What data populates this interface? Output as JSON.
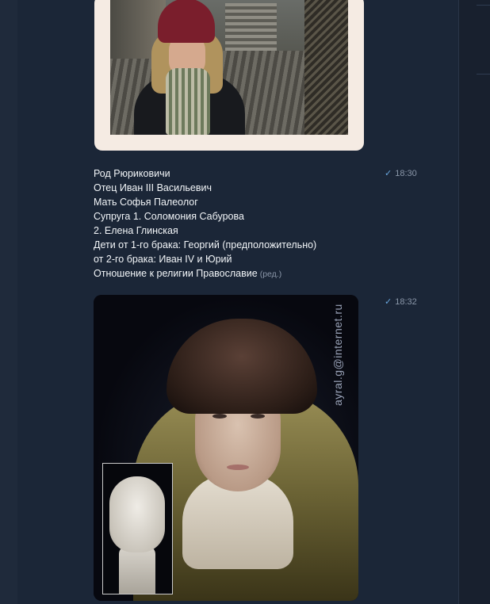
{
  "messages": [
    {
      "type": "photo",
      "description_icon": "photo-woman-street"
    },
    {
      "type": "text",
      "time": "18:30",
      "lines": [
        "Род Рюриковичи",
        "Отец Иван III Васильевич",
        "Мать Софья Палеолог",
        "Супруга 1. Соломония Сабурова",
        "2. Елена Глинская",
        "Дети от 1-го брака: Георгий (предположительно)",
        "от 2-го брака: Иван IV и Юрий",
        "Отношение к религии Православие"
      ],
      "edited_label": "(ред.)"
    },
    {
      "type": "photo",
      "time": "18:32",
      "watermark": "ayral.g@internet.ru"
    }
  ],
  "colors": {
    "background": "#1b2637",
    "text": "#f2f5f8",
    "meta": "#8a96a8",
    "check": "#6aa8e0"
  },
  "icons": {
    "read_status": "check-icon"
  }
}
